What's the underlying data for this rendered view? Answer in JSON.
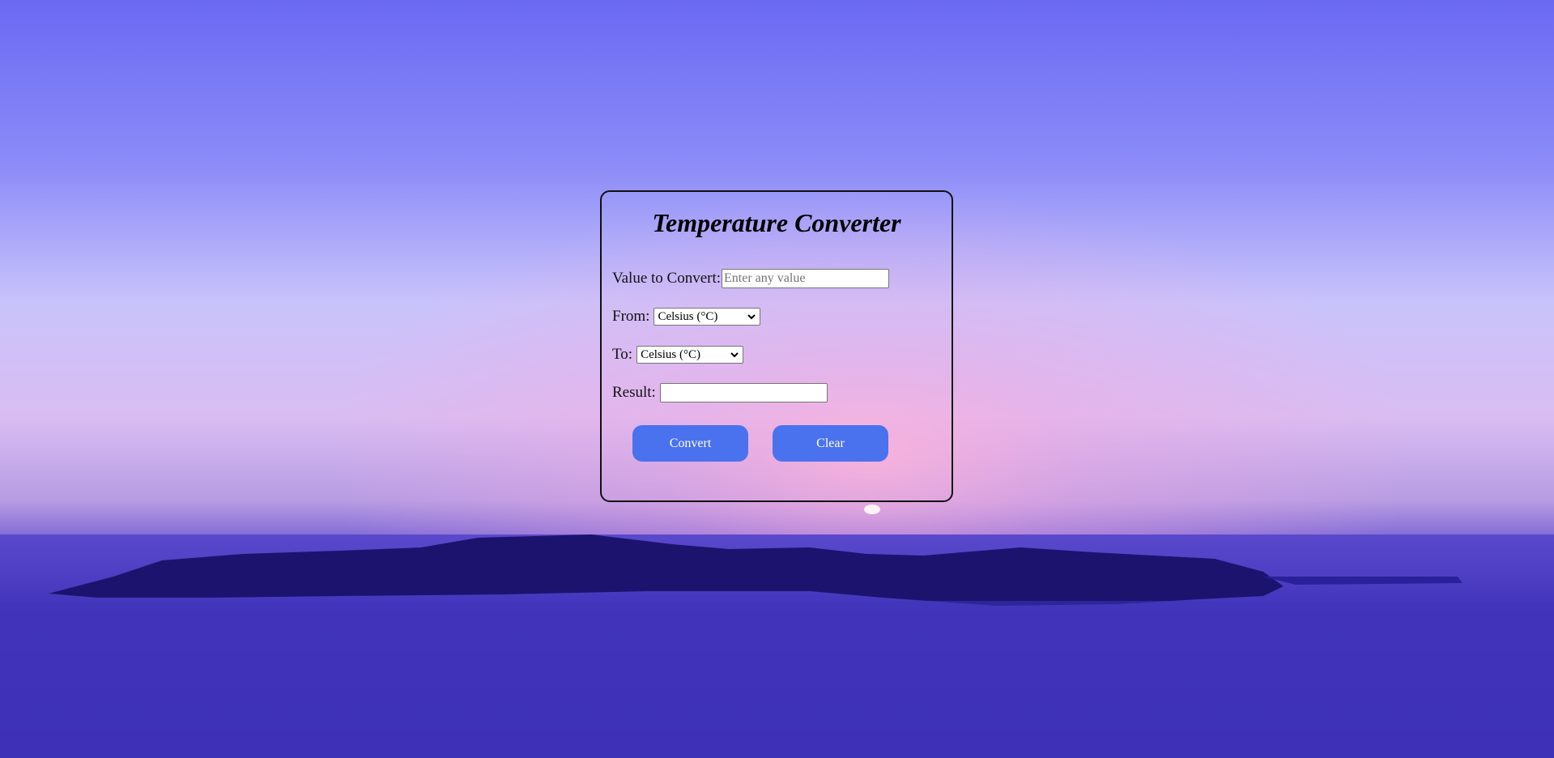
{
  "page": {
    "title": "Temperature Converter"
  },
  "form": {
    "value_label": "Value to Convert:",
    "value_placeholder": "Enter any value",
    "value_current": "",
    "from_label": "From:",
    "from_selected": "Celsius (°C)",
    "to_label": "To:",
    "to_selected": "Celsius (°C)",
    "result_label": "Result:",
    "result_value": ""
  },
  "buttons": {
    "convert_label": "Convert",
    "clear_label": "Clear"
  },
  "colors": {
    "button_bg": "#4a72ee",
    "button_text": "#ffffff",
    "card_border": "#111111",
    "sky_top": "#6d6cf4",
    "sky_glow": "#f2b5dc",
    "sea": "#3e33b8"
  },
  "icons": {
    "select_arrow": "chevron-down-icon"
  }
}
